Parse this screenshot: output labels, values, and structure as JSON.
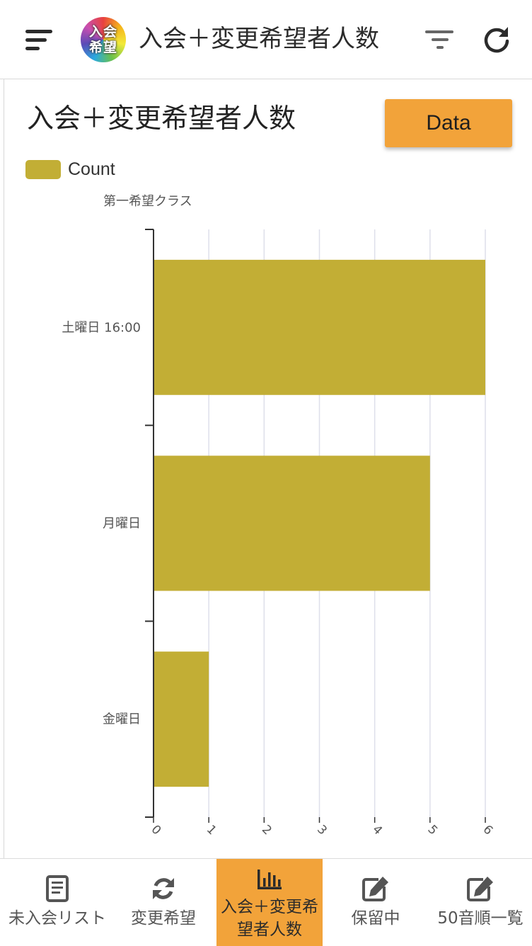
{
  "header": {
    "logo_line1": "入会",
    "logo_line2": "希望",
    "title": "入会＋変更希望者人数"
  },
  "page": {
    "title": "入会＋変更希望者人数",
    "data_button": "Data"
  },
  "colors": {
    "bar": "#c2ae35",
    "accent": "#f2a33a",
    "grid": "#dedfea"
  },
  "chart_data": {
    "type": "bar",
    "orientation": "horizontal",
    "title": "",
    "ylabel": "第一希望クラス",
    "xlabel": "",
    "categories": [
      "土曜日 16:00",
      "月曜日",
      "金曜日"
    ],
    "series": [
      {
        "name": "Count",
        "values": [
          6,
          5,
          1
        ]
      }
    ],
    "xlim": [
      0,
      6
    ],
    "xticks": [
      "0",
      "1",
      "2",
      "3",
      "4",
      "5",
      "6"
    ],
    "grid": true,
    "legend": "top-left"
  },
  "bottom_nav": {
    "items": [
      {
        "label": "未入会リスト",
        "icon": "book-icon"
      },
      {
        "label": "変更希望",
        "icon": "sync-icon"
      },
      {
        "label": "入会＋変更希望者人数",
        "icon": "bar-chart-icon",
        "active": true
      },
      {
        "label": "保留中",
        "icon": "edit-icon"
      },
      {
        "label": "50音順一覧",
        "icon": "edit-icon"
      }
    ]
  }
}
